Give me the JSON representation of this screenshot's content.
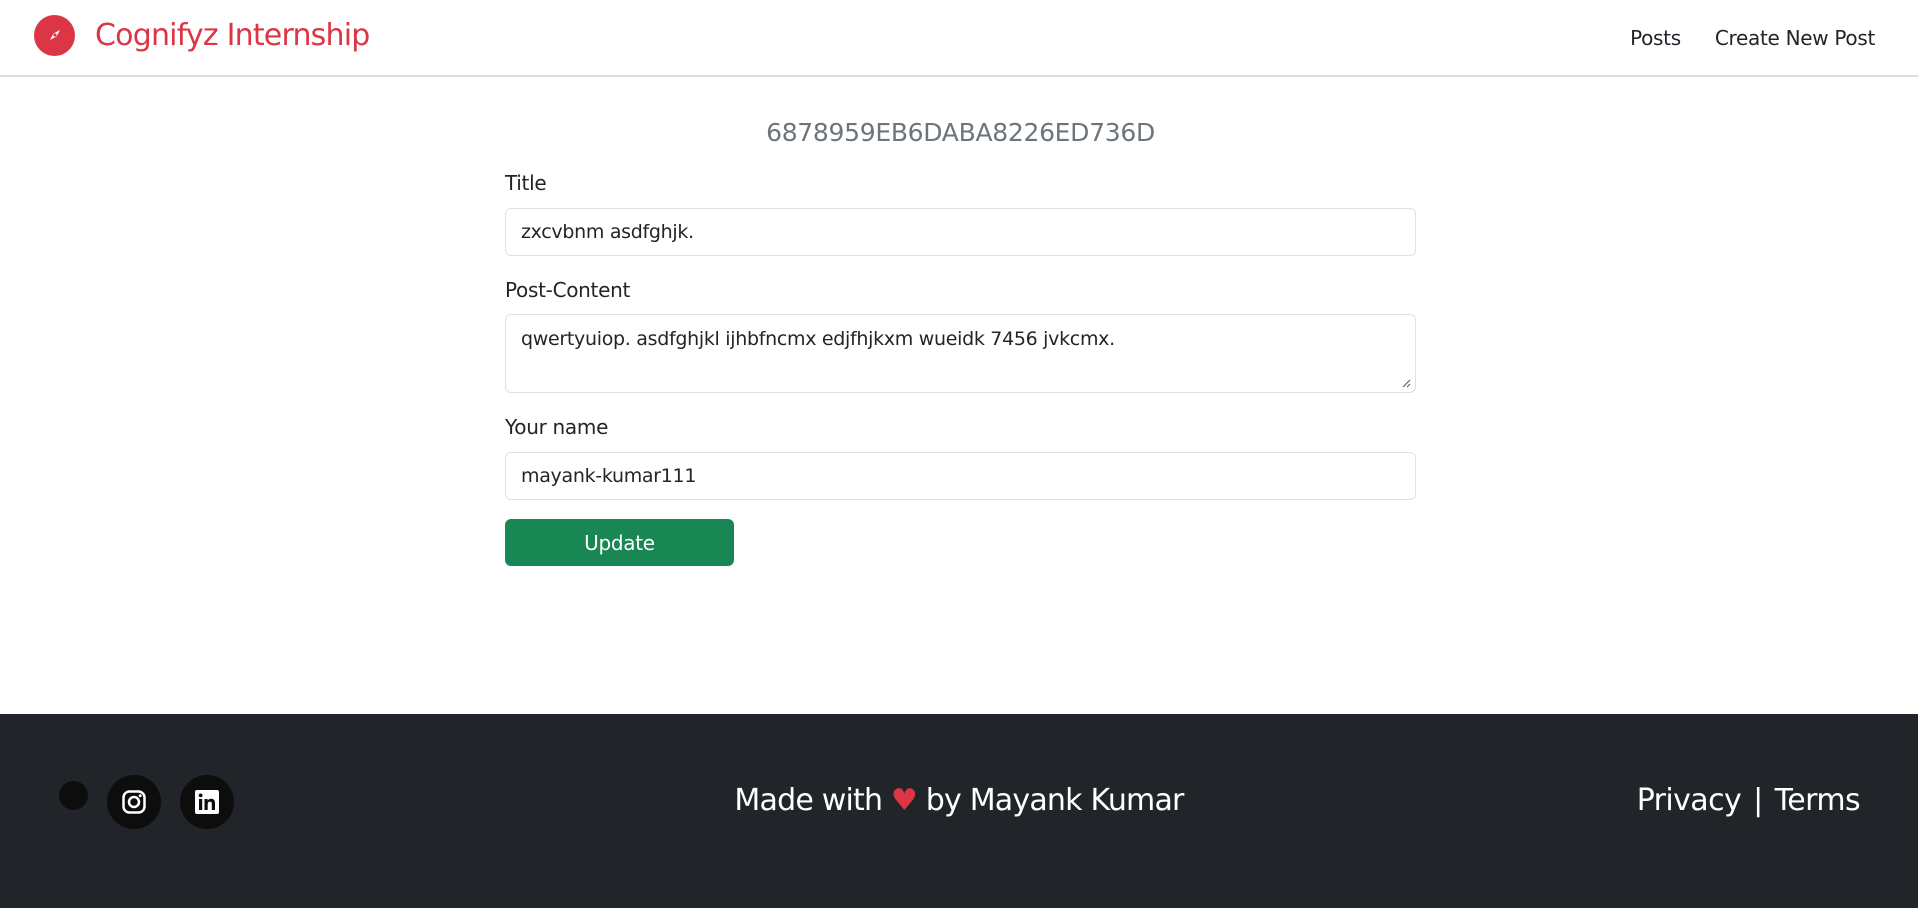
{
  "navbar": {
    "brand": "Cognifyz Internship",
    "brand_icon": "compass-icon",
    "links": [
      {
        "label": "Posts"
      },
      {
        "label": "Create New Post"
      }
    ]
  },
  "form": {
    "post_id": "6878959EB6DABA8226ED736D",
    "title_label": "Title",
    "title_value": "zxcvbnm asdfghjk.",
    "content_label": "Post-Content",
    "content_value": "qwertyuiop. asdfghjkl ijhbfncmx edjfhjkxm wueidk 7456 jvkcmx.",
    "name_label": "Your name",
    "name_value": "mayank-kumar111",
    "submit_label": "Update"
  },
  "footer": {
    "made_with_prefix": "Made with",
    "heart": "♥",
    "made_with_suffix": "by Mayank Kumar",
    "privacy": "Privacy",
    "separator": "|",
    "terms": "Terms",
    "social_icons": [
      "instagram-icon",
      "linkedin-icon"
    ]
  },
  "colors": {
    "brand": "#dc3545",
    "success": "#198754",
    "footer_bg": "#212529",
    "muted": "#6c757d"
  }
}
